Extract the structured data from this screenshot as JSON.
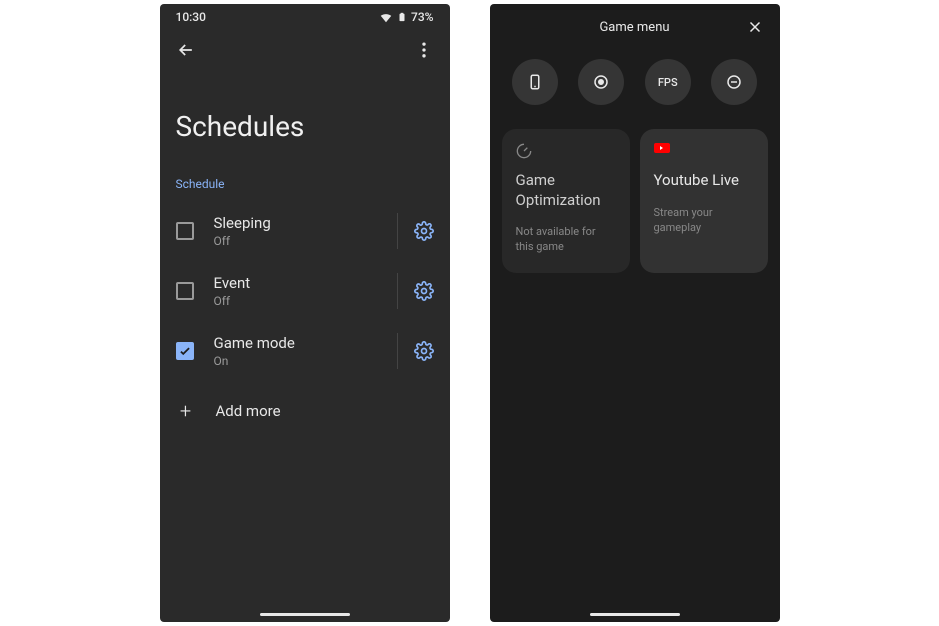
{
  "statusbar": {
    "time": "10:30",
    "battery": "73%"
  },
  "schedules": {
    "title": "Schedules",
    "section_label": "Schedule",
    "items": [
      {
        "title": "Sleeping",
        "sub": "Off",
        "checked": false
      },
      {
        "title": "Event",
        "sub": "Off",
        "checked": false
      },
      {
        "title": "Game mode",
        "sub": "On",
        "checked": true
      }
    ],
    "add_more": "Add more"
  },
  "gamemenu": {
    "title": "Game menu",
    "buttons": {
      "fps_label": "FPS"
    },
    "cards": {
      "optimization": {
        "title": "Game Optimization",
        "sub": "Not available for this game"
      },
      "youtube": {
        "title": "Youtube Live",
        "sub": "Stream your gameplay"
      }
    }
  }
}
